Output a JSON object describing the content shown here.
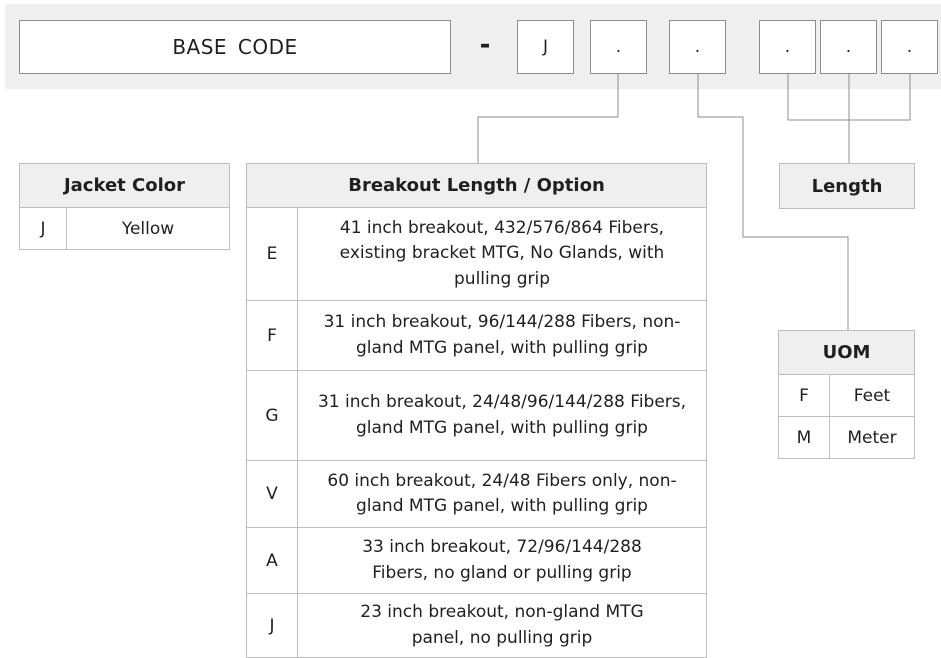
{
  "header": {
    "base_code": "BASE  CODE",
    "separator": "-",
    "segments": [
      "J",
      ".",
      ".",
      ".",
      ".",
      "."
    ]
  },
  "jacket_color": {
    "title": "Jacket Color",
    "rows": [
      {
        "code": "J",
        "label": "Yellow"
      }
    ]
  },
  "breakout": {
    "title": "Breakout Length / Option",
    "rows": [
      {
        "code": "E",
        "desc": "41 inch breakout, 432/576/864 Fibers, existing bracket MTG, No Glands, with pulling grip"
      },
      {
        "code": "F",
        "desc": "31 inch breakout, 96/144/288 Fibers, non-gland MTG panel, with pulling grip"
      },
      {
        "code": "G",
        "desc": "31 inch breakout, 24/48/96/144/288 Fibers, gland MTG panel, with pulling grip"
      },
      {
        "code": "V",
        "desc": "60 inch breakout, 24/48 Fibers only, non-gland MTG panel, with pulling grip"
      },
      {
        "code": "A",
        "desc": "33 inch breakout, 72/96/144/288 Fibers, no gland or pulling grip"
      },
      {
        "code": "J",
        "desc": "23 inch breakout, non-gland MTG panel, no pulling grip"
      }
    ]
  },
  "length": {
    "title": "Length"
  },
  "uom": {
    "title": "UOM",
    "rows": [
      {
        "code": "F",
        "label": "Feet"
      },
      {
        "code": "M",
        "label": "Meter"
      }
    ]
  },
  "colors": {
    "header_band": "#efefef",
    "table_header": "#efefef",
    "border": "#bdbdbd",
    "connector": "#8c8c8c"
  }
}
